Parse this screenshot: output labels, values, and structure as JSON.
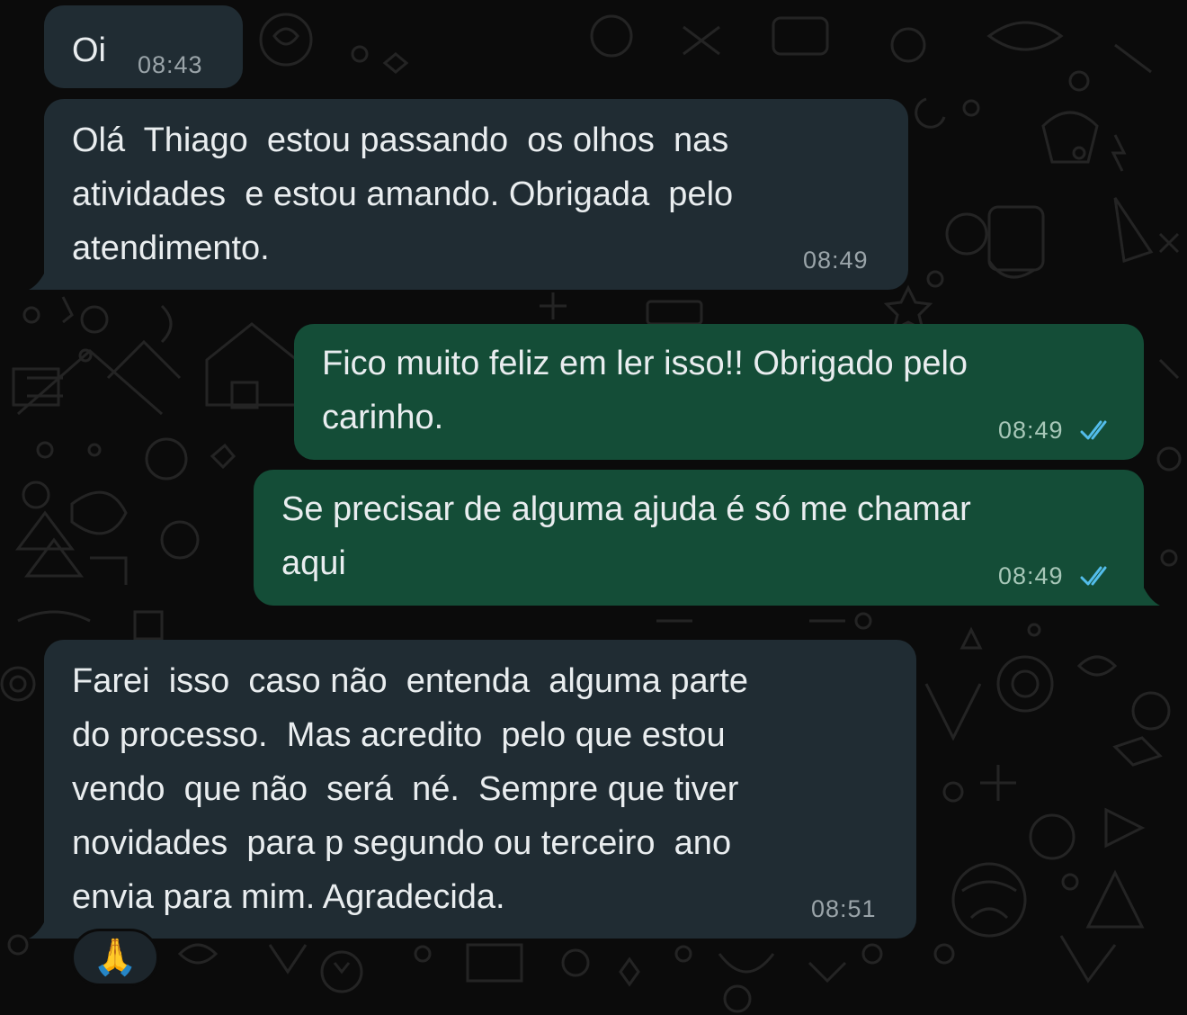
{
  "conversation": {
    "messages": [
      {
        "direction": "incoming",
        "text": "Oi",
        "time": "08:43"
      },
      {
        "direction": "incoming",
        "text": "Olá  Thiago  estou passando  os olhos  nas\natividades  e estou amando. Obrigada  pelo\natendimento.",
        "time": "08:49"
      },
      {
        "direction": "outgoing",
        "text": "Fico muito feliz em ler isso!! Obrigado pelo\ncarinho.",
        "time": "08:49",
        "status": "read"
      },
      {
        "direction": "outgoing",
        "text": "Se precisar de alguma ajuda é só me chamar\naqui",
        "time": "08:49",
        "status": "read"
      },
      {
        "direction": "incoming",
        "text": "Farei  isso  caso não  entenda  alguma parte\ndo processo.  Mas acredito  pelo que estou\nvendo  que não  será  né.  Sempre que tiver\nnovidades  para p segundo ou terceiro  ano\nenvia para mim. Agradecida.",
        "time": "08:51",
        "reaction": "🙏"
      }
    ]
  },
  "colors": {
    "background": "#0b0b0b",
    "incoming_bubble": "#202c33",
    "outgoing_bubble": "#144d37",
    "read_ticks": "#53bdeb",
    "text": "#e9edef"
  },
  "icons": {
    "read_receipt": "double-check-icon",
    "wallpaper": "doodle-pattern"
  }
}
